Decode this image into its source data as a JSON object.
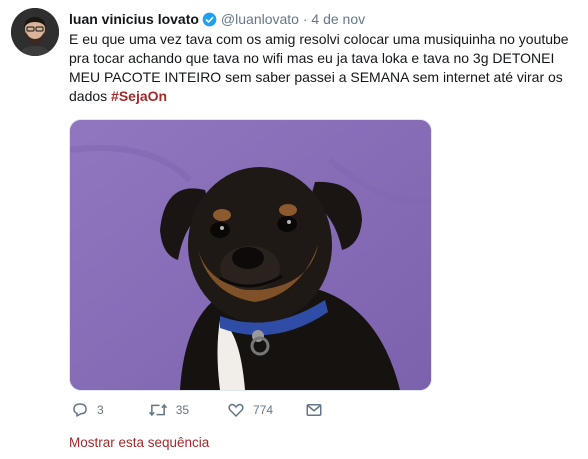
{
  "tweet": {
    "author_name": "luan vinicius lovato",
    "handle": "@luanlovato",
    "separator": "·",
    "date": "4 de nov",
    "text": "E eu que uma vez tava com os amig resolvi colocar uma musiquinha no youtube pra tocar achando que tava no wifi mas eu ja tava loka e tava no 3g DETONEI MEU PACOTE INTEIRO sem saber passei a SEMANA sem internet até virar os dados",
    "hashtag": "#SejaOn",
    "accent_color": "#a32a2a",
    "media_icon": "smiling-dog-photo"
  },
  "actions": {
    "replies": "3",
    "retweets": "35",
    "likes": "774"
  },
  "show_thread_label": "Mostrar esta sequência"
}
